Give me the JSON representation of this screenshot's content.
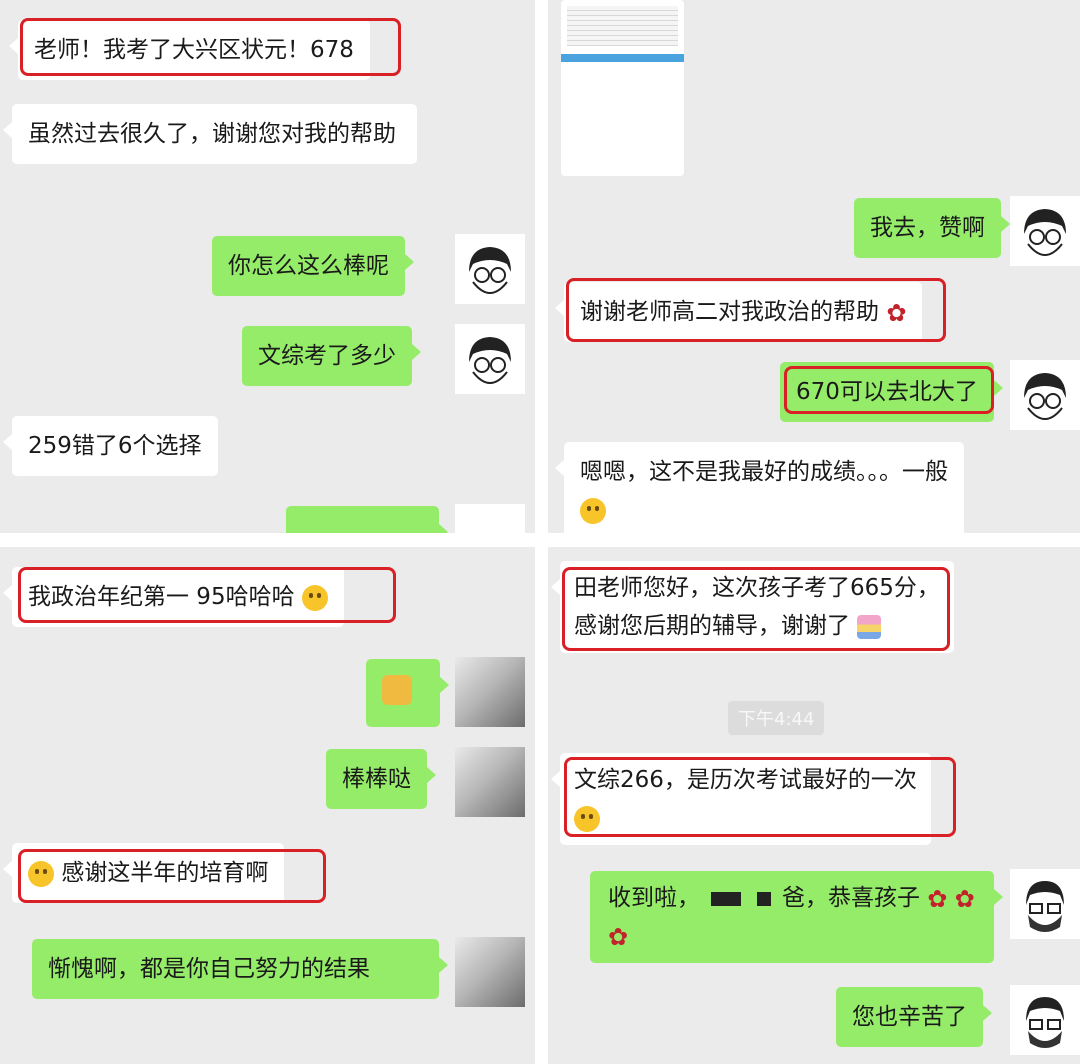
{
  "panel1": {
    "msg1": "老师！我考了大兴区状元！678",
    "msg2": "虽然过去很久了，谢谢您对我的帮助",
    "msg3": "你怎么这么棒呢",
    "msg4": "文综考了多少",
    "msg5": "259错了6个选择"
  },
  "panel2": {
    "msg1": "我去，赞啊",
    "msg2": "谢谢老师高二对我政治的帮助",
    "msg3": "670可以去北大了",
    "msg4": "嗯嗯，这不是我最好的成绩。。。一般"
  },
  "panel3": {
    "msg1": "我政治年纪第一 95哈哈哈",
    "msg2": "棒棒哒",
    "msg3": "感谢这半年的培育啊",
    "msg4": "惭愧啊，都是你自己努力的结果"
  },
  "panel4": {
    "msg1_line1": "田老师您好，这次孩子考了665分，",
    "msg1_line2": "感谢您后期的辅导，谢谢了",
    "time": "下午4:44",
    "msg2": "文综266，是历次考试最好的一次",
    "msg3_a": "收到啦，",
    "msg3_b": "爸，恭喜孩子",
    "msg4": "您也辛苦了"
  },
  "colors": {
    "incoming": "#ffffff",
    "outgoing": "#95ec69",
    "highlight": "#d92027",
    "background": "#ebebeb"
  },
  "icons": [
    "rose-icon",
    "facepalm-emoji-icon",
    "thinking-emoji-icon",
    "thumbs-up-emoji-icon",
    "cake-emoji-icon",
    "grin-emoji-icon"
  ]
}
